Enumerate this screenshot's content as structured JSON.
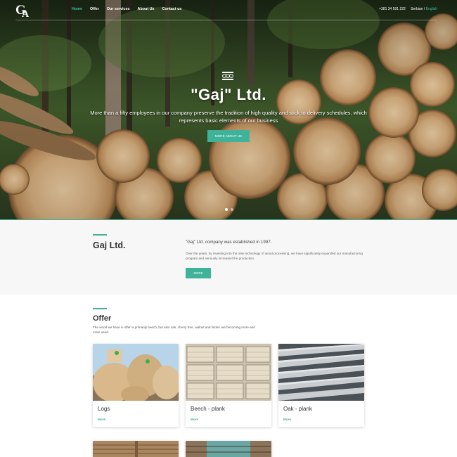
{
  "header": {
    "logo": "GA",
    "nav": [
      {
        "label": "Home",
        "active": true
      },
      {
        "label": "Offer",
        "active": false
      },
      {
        "label": "Our services",
        "active": false
      },
      {
        "label": "About Us",
        "active": false
      },
      {
        "label": "Contact us",
        "active": false
      }
    ],
    "phone": "+381 34 591 222",
    "lang_serbian": "Serbian",
    "lang_separator": "/",
    "lang_english": "English"
  },
  "hero": {
    "title": "\"Gaj\" Ltd.",
    "subtitle": "More than a fifty employees in our company preserve the tradition of high quality and stick to delivery schedules, which represents basic elements of our business",
    "button": "MORE ABOUT US",
    "slides": 2,
    "active_slide": 1
  },
  "about": {
    "title": "Gaj Ltd.",
    "lead": "\"Gaj\" Ltd. company was established in 1997.",
    "body": "Over the years, by investing into the new technology of wood processing, we have significantly expanded our manufacturing program and seriously increased the production.",
    "button": "MORE"
  },
  "offer": {
    "title": "Offer",
    "description": "The wood we have in offer is primarily beech, but also oak, cherry tree, walnut and linden are becoming more and more used.",
    "cards": [
      {
        "title": "Logs",
        "more": "More"
      },
      {
        "title": "Beech - plank",
        "more": "More"
      },
      {
        "title": "Oak - plank",
        "more": "More"
      }
    ]
  },
  "colors": {
    "accent": "#3fb29a",
    "nav_active": "#3fc0a4"
  }
}
